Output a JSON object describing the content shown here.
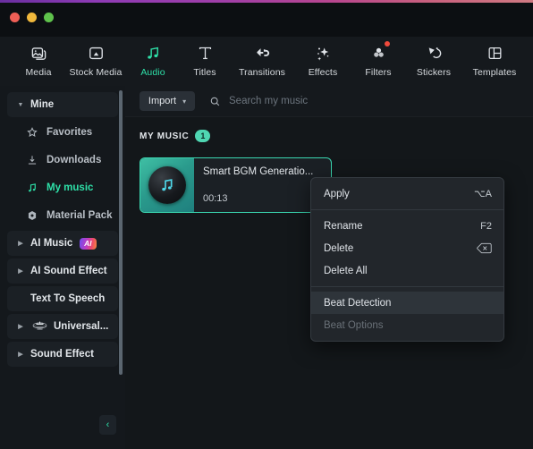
{
  "window": {
    "traffic_lights": [
      "close",
      "minimize",
      "zoom"
    ]
  },
  "toolbar": {
    "items": [
      {
        "id": "media",
        "label": "Media",
        "icon": "media-image-icon",
        "active": false,
        "dot": false
      },
      {
        "id": "stock-media",
        "label": "Stock Media",
        "icon": "stock-media-icon",
        "active": false,
        "dot": false
      },
      {
        "id": "audio",
        "label": "Audio",
        "icon": "music-note-icon",
        "active": true,
        "dot": false
      },
      {
        "id": "titles",
        "label": "Titles",
        "icon": "text-t-icon",
        "active": false,
        "dot": false
      },
      {
        "id": "transitions",
        "label": "Transitions",
        "icon": "transitions-icon",
        "active": false,
        "dot": false
      },
      {
        "id": "effects",
        "label": "Effects",
        "icon": "sparkle-icon",
        "active": false,
        "dot": false
      },
      {
        "id": "filters",
        "label": "Filters",
        "icon": "filters-circles-icon",
        "active": false,
        "dot": true
      },
      {
        "id": "stickers",
        "label": "Stickers",
        "icon": "sticker-icon",
        "active": false,
        "dot": false
      },
      {
        "id": "templates",
        "label": "Templates",
        "icon": "templates-grid-icon",
        "active": false,
        "dot": false
      }
    ],
    "accent_color": "#2ee0a8",
    "notification_dot_color": "#f04a3c"
  },
  "sidebar": {
    "items": [
      {
        "id": "mine",
        "label": "Mine",
        "type": "group",
        "expanded": true,
        "icon": null,
        "selected": false
      },
      {
        "id": "favorites",
        "label": "Favorites",
        "type": "child",
        "icon": "star-icon",
        "selected": false
      },
      {
        "id": "downloads",
        "label": "Downloads",
        "type": "child",
        "icon": "download-icon",
        "selected": false
      },
      {
        "id": "my-music",
        "label": "My music",
        "type": "child",
        "icon": "music-note-icon",
        "selected": true
      },
      {
        "id": "material-pack",
        "label": "Material Pack",
        "type": "child",
        "icon": "package-icon",
        "selected": false
      },
      {
        "id": "ai-music",
        "label": "AI Music",
        "type": "group",
        "expanded": false,
        "badge": "AI",
        "selected": false
      },
      {
        "id": "ai-sound-effect",
        "label": "AI Sound Effect",
        "type": "group",
        "expanded": false,
        "selected": false
      },
      {
        "id": "text-to-speech",
        "label": "Text To Speech",
        "type": "plain",
        "selected": false
      },
      {
        "id": "universal",
        "label": "Universal...",
        "type": "group",
        "expanded": false,
        "icon": "universal-music-logo-icon",
        "selected": false
      },
      {
        "id": "sound-effect",
        "label": "Sound Effect",
        "type": "group",
        "expanded": false,
        "selected": false
      }
    ],
    "collapse_button": "‹",
    "accent_color": "#2ee0a8"
  },
  "content": {
    "import": {
      "label": "Import",
      "chevron": "▾"
    },
    "search": {
      "placeholder": "Search my music",
      "value": ""
    },
    "section": {
      "title": "MY MUSIC",
      "count": "1"
    },
    "card": {
      "title": "Smart BGM Generatio...",
      "duration": "00:13",
      "thumbnail_icon": "music-note-vinyl-icon",
      "selected": true
    }
  },
  "context_menu": {
    "items": [
      {
        "id": "apply",
        "label": "Apply",
        "shortcut": "⌥A",
        "shortcut_type": "text",
        "selected": false,
        "disabled": false,
        "separator_after": true
      },
      {
        "id": "rename",
        "label": "Rename",
        "shortcut": "F2",
        "shortcut_type": "text",
        "selected": false,
        "disabled": false,
        "separator_after": false
      },
      {
        "id": "delete",
        "label": "Delete",
        "shortcut": "⌫",
        "shortcut_type": "key",
        "selected": false,
        "disabled": false,
        "separator_after": false
      },
      {
        "id": "delete-all",
        "label": "Delete All",
        "shortcut": "",
        "shortcut_type": "none",
        "selected": false,
        "disabled": false,
        "separator_after": true
      },
      {
        "id": "beat-detection",
        "label": "Beat Detection",
        "shortcut": "",
        "shortcut_type": "none",
        "selected": true,
        "disabled": false,
        "separator_after": false
      },
      {
        "id": "beat-options",
        "label": "Beat Options",
        "shortcut": "",
        "shortcut_type": "none",
        "selected": false,
        "disabled": true,
        "separator_after": false
      }
    ]
  }
}
